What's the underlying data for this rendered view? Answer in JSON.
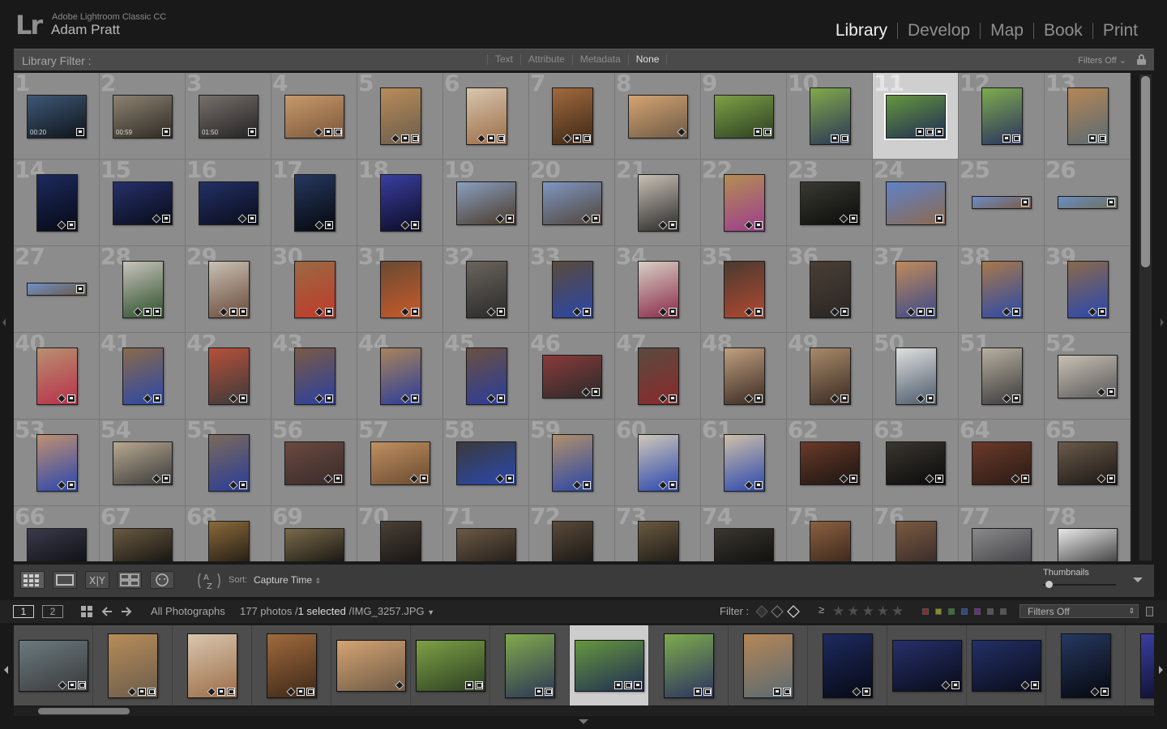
{
  "app": {
    "product": "Adobe Lightroom Classic CC",
    "user": "Adam Pratt",
    "logo": "Lr"
  },
  "modules": [
    {
      "label": "Library",
      "active": true
    },
    {
      "label": "Develop",
      "active": false
    },
    {
      "label": "Map",
      "active": false
    },
    {
      "label": "Book",
      "active": false
    },
    {
      "label": "Print",
      "active": false
    }
  ],
  "library_filter": {
    "label": "Library Filter :",
    "tabs": [
      {
        "label": "Text",
        "active": false
      },
      {
        "label": "Attribute",
        "active": false
      },
      {
        "label": "Metadata",
        "active": false
      },
      {
        "label": "None",
        "active": true
      }
    ],
    "preset": "Filters Off",
    "lock_icon": "lock-icon"
  },
  "grid": {
    "selected_index": 11,
    "cells": [
      {
        "n": "1",
        "c1": "#3e5878",
        "c2": "#0f1418",
        "o": "h",
        "dur": "00:20",
        "badges": [
          "cm"
        ]
      },
      {
        "n": "2",
        "c1": "#8d8273",
        "c2": "#2f2a22",
        "o": "h",
        "dur": "00:59",
        "badges": [
          "cm"
        ]
      },
      {
        "n": "3",
        "c1": "#77706a",
        "c2": "#242225",
        "o": "h",
        "dur": "01:50",
        "badges": [
          "cm"
        ]
      },
      {
        "n": "4",
        "c1": "#c79a6b",
        "c2": "#7b573a",
        "o": "h",
        "badges": [
          "kw",
          "cm",
          "cp"
        ]
      },
      {
        "n": "5",
        "c1": "#b88c5a",
        "c2": "#6b5c4a",
        "o": "v",
        "badges": [
          "kw",
          "cm",
          "cp"
        ]
      },
      {
        "n": "6",
        "c1": "#d8c6ae",
        "c2": "#9c6d47",
        "o": "v",
        "badges": [
          "kw",
          "cm",
          "cp"
        ]
      },
      {
        "n": "7",
        "c1": "#a06a3d",
        "c2": "#3d2717",
        "o": "v",
        "badges": [
          "kw",
          "cm",
          "cp"
        ]
      },
      {
        "n": "8",
        "c1": "#d4a473",
        "c2": "#6e5a45",
        "o": "h",
        "badges": [
          "kw"
        ]
      },
      {
        "n": "9",
        "c1": "#7fa046",
        "c2": "#2b3f22",
        "o": "h",
        "badges": [
          "cm",
          "cp"
        ]
      },
      {
        "n": "10",
        "c1": "#81a94b",
        "c2": "#2c3656",
        "o": "v",
        "badges": [
          "cm",
          "cp"
        ]
      },
      {
        "n": "11",
        "c1": "#66963e",
        "c2": "#1f2d53",
        "o": "h",
        "badges": [
          "cm",
          "cp",
          "ed"
        ]
      },
      {
        "n": "12",
        "c1": "#7eab4d",
        "c2": "#2b3260",
        "o": "v",
        "badges": [
          "cm",
          "cp"
        ]
      },
      {
        "n": "13",
        "c1": "#b58656",
        "c2": "#5a6a72",
        "o": "v",
        "badges": [
          "cm",
          "cp"
        ]
      },
      {
        "n": "14",
        "c1": "#1d2a5e",
        "c2": "#060914",
        "o": "v",
        "badges": [
          "kw",
          "cm"
        ]
      },
      {
        "n": "15",
        "c1": "#26306a",
        "c2": "#080b18",
        "o": "h",
        "badges": [
          "kw",
          "cm"
        ]
      },
      {
        "n": "16",
        "c1": "#223066",
        "c2": "#0a0c1a",
        "o": "h",
        "badges": [
          "kw",
          "cm"
        ]
      },
      {
        "n": "17",
        "c1": "#263860",
        "c2": "#05070c",
        "o": "v",
        "badges": [
          "kw",
          "cm"
        ]
      },
      {
        "n": "18",
        "c1": "#3a3fa0",
        "c2": "#0b0b25",
        "o": "v",
        "badges": [
          "kw",
          "cm"
        ]
      },
      {
        "n": "19",
        "c1": "#8a9fc0",
        "c2": "#4a3a2a",
        "o": "h",
        "badges": [
          "kw",
          "cm"
        ]
      },
      {
        "n": "20",
        "c1": "#7e97c2",
        "c2": "#51443a",
        "o": "h",
        "badges": [
          "kw",
          "cm"
        ]
      },
      {
        "n": "21",
        "c1": "#c8c0b5",
        "c2": "#2b2b2b",
        "o": "v",
        "badges": [
          "kw",
          "cm"
        ]
      },
      {
        "n": "22",
        "c1": "#b38e53",
        "c2": "#9d3d8e",
        "o": "v",
        "badges": [
          "kw",
          "cm"
        ]
      },
      {
        "n": "23",
        "c1": "#3a3a32",
        "c2": "#0a0a0a",
        "o": "h",
        "badges": [
          "kw",
          "cm"
        ]
      },
      {
        "n": "24",
        "c1": "#5f82c8",
        "c2": "#8c6a4f",
        "o": "h",
        "badges": [
          "cm"
        ]
      },
      {
        "n": "25",
        "c1": "#6a8cc8",
        "c2": "#7d5a3f",
        "o": "p",
        "badges": [
          "cm"
        ]
      },
      {
        "n": "26",
        "c1": "#6c8ec4",
        "c2": "#6d6f5a",
        "o": "p",
        "badges": [
          "cm"
        ]
      },
      {
        "n": "27",
        "c1": "#7090c8",
        "c2": "#6a5a45",
        "o": "p",
        "badges": [
          "cm"
        ]
      },
      {
        "n": "28",
        "c1": "#c8c3bc",
        "c2": "#2c4f2a",
        "o": "v",
        "badges": [
          "kw",
          "cm",
          "ed"
        ]
      },
      {
        "n": "29",
        "c1": "#c8c0b5",
        "c2": "#6a4a38",
        "o": "v",
        "badges": [
          "kw",
          "cm",
          "ed"
        ]
      },
      {
        "n": "30",
        "c1": "#9a6a43",
        "c2": "#c03a2a",
        "o": "v",
        "badges": [
          "kw",
          "cm"
        ]
      },
      {
        "n": "31",
        "c1": "#6a4a32",
        "c2": "#c85a2a",
        "o": "v",
        "badges": [
          "kw",
          "cm"
        ]
      },
      {
        "n": "32",
        "c1": "#6a645c",
        "c2": "#2a2a2a",
        "o": "v",
        "badges": [
          "kw",
          "cm"
        ]
      },
      {
        "n": "33",
        "c1": "#5a4a3a",
        "c2": "#2a46a8",
        "o": "v",
        "badges": [
          "kw",
          "cm"
        ]
      },
      {
        "n": "34",
        "c1": "#d8d0c4",
        "c2": "#8a2a4a",
        "o": "v",
        "badges": [
          "kw",
          "cm"
        ]
      },
      {
        "n": "35",
        "c1": "#4a3a30",
        "c2": "#b04830",
        "o": "v",
        "badges": [
          "kw",
          "cm"
        ]
      },
      {
        "n": "36",
        "c1": "#4a3e34",
        "c2": "#2a2624",
        "o": "v",
        "badges": [
          "kw",
          "cm"
        ]
      },
      {
        "n": "37",
        "c1": "#c08a5a",
        "c2": "#3a4a8a",
        "o": "v",
        "badges": [
          "kw",
          "cm",
          "ed"
        ]
      },
      {
        "n": "38",
        "c1": "#a8784a",
        "c2": "#2a4aa8",
        "o": "v",
        "badges": [
          "kw",
          "cm"
        ]
      },
      {
        "n": "39",
        "c1": "#8a6a4a",
        "c2": "#2a46b0",
        "o": "v",
        "badges": [
          "kw",
          "cm"
        ]
      },
      {
        "n": "40",
        "c1": "#b89070",
        "c2": "#b8304a",
        "o": "v",
        "badges": [
          "kw",
          "cm"
        ]
      },
      {
        "n": "41",
        "c1": "#8a6a4a",
        "c2": "#2a48a8",
        "o": "v",
        "badges": [
          "kw",
          "cm"
        ]
      },
      {
        "n": "42",
        "c1": "#b8503a",
        "c2": "#3a3a3a",
        "o": "v",
        "badges": [
          "kw",
          "cm"
        ]
      },
      {
        "n": "43",
        "c1": "#7a5a44",
        "c2": "#2a40a0",
        "o": "v",
        "badges": [
          "kw",
          "cm"
        ]
      },
      {
        "n": "44",
        "c1": "#a8845c",
        "c2": "#2a3c9a",
        "o": "v",
        "badges": [
          "kw",
          "cm"
        ]
      },
      {
        "n": "45",
        "c1": "#6a5040",
        "c2": "#2a3c9a",
        "o": "v",
        "badges": [
          "kw",
          "cm"
        ]
      },
      {
        "n": "46",
        "c1": "#8a3a3a",
        "c2": "#2a2a2a",
        "o": "h",
        "badges": [
          "kw",
          "cm"
        ]
      },
      {
        "n": "47",
        "c1": "#5a4a40",
        "c2": "#8a2a2a",
        "o": "v",
        "badges": [
          "kw",
          "cm"
        ]
      },
      {
        "n": "48",
        "c1": "#c0a080",
        "c2": "#3a2a22",
        "o": "v",
        "badges": [
          "kw",
          "cm"
        ]
      },
      {
        "n": "49",
        "c1": "#a88a6a",
        "c2": "#3a2a22",
        "o": "v",
        "badges": [
          "kw",
          "cm"
        ]
      },
      {
        "n": "50",
        "c1": "#e0e0e0",
        "c2": "#4a5a6a",
        "o": "v",
        "badges": [
          "kw",
          "cm"
        ]
      },
      {
        "n": "51",
        "c1": "#b8b0a0",
        "c2": "#3a3a3a",
        "o": "v",
        "badges": [
          "kw",
          "cm"
        ]
      },
      {
        "n": "52",
        "c1": "#c8c0b4",
        "c2": "#5a5a5a",
        "o": "h",
        "badges": [
          "kw",
          "cm"
        ]
      },
      {
        "n": "53",
        "c1": "#c09070",
        "c2": "#2a46b0",
        "o": "v",
        "badges": [
          "kw",
          "cm"
        ]
      },
      {
        "n": "54",
        "c1": "#b8a890",
        "c2": "#3a3a3a",
        "o": "h",
        "badges": [
          "kw",
          "cm"
        ]
      },
      {
        "n": "55",
        "c1": "#7a6a5a",
        "c2": "#2a3c98",
        "o": "v",
        "badges": [
          "kw",
          "cm"
        ]
      },
      {
        "n": "56",
        "c1": "#6a4a40",
        "c2": "#3a2a2a",
        "o": "h",
        "badges": [
          "kw",
          "cm"
        ]
      },
      {
        "n": "57",
        "c1": "#c09060",
        "c2": "#6a4a30",
        "o": "h",
        "badges": [
          "kw",
          "cm"
        ]
      },
      {
        "n": "58",
        "c1": "#3a3a3a",
        "c2": "#2a48b0",
        "o": "h",
        "badges": [
          "kw",
          "cm"
        ]
      },
      {
        "n": "59",
        "c1": "#b0906a",
        "c2": "#2a46a8",
        "o": "v",
        "badges": [
          "kw",
          "cm"
        ]
      },
      {
        "n": "60",
        "c1": "#d0c8b8",
        "c2": "#2a46b0",
        "o": "v",
        "badges": [
          "kw",
          "cm"
        ]
      },
      {
        "n": "61",
        "c1": "#d0c0a8",
        "c2": "#2a48b0",
        "o": "v",
        "badges": [
          "kw",
          "cm"
        ]
      },
      {
        "n": "62",
        "c1": "#6a3a2a",
        "c2": "#1a1410",
        "o": "h",
        "badges": [
          "kw",
          "cm"
        ]
      },
      {
        "n": "63",
        "c1": "#3a3630",
        "c2": "#0a0a0a",
        "o": "h",
        "badges": [
          "kw",
          "cm"
        ]
      },
      {
        "n": "64",
        "c1": "#6a3a2a",
        "c2": "#2a1a14",
        "o": "h",
        "badges": [
          "kw",
          "cm"
        ]
      },
      {
        "n": "65",
        "c1": "#6a5a4a",
        "c2": "#1a1614",
        "o": "h",
        "badges": [
          "kw",
          "cm"
        ]
      },
      {
        "n": "66",
        "c1": "#3a3a4a",
        "c2": "#0a0a10",
        "o": "h",
        "badges": []
      },
      {
        "n": "67",
        "c1": "#6a5a40",
        "c2": "#0a0a0a",
        "o": "h",
        "badges": []
      },
      {
        "n": "68",
        "c1": "#8a6a3a",
        "c2": "#0a0a0a",
        "o": "v",
        "badges": []
      },
      {
        "n": "69",
        "c1": "#7a6a4a",
        "c2": "#0a0a0a",
        "o": "h",
        "badges": []
      },
      {
        "n": "70",
        "c1": "#4a4036",
        "c2": "#0a0a0a",
        "o": "v",
        "badges": []
      },
      {
        "n": "71",
        "c1": "#6a5a44",
        "c2": "#1a1414",
        "o": "h",
        "badges": []
      },
      {
        "n": "72",
        "c1": "#5a4a3a",
        "c2": "#0a0a0a",
        "o": "v",
        "badges": []
      },
      {
        "n": "73",
        "c1": "#6a5a40",
        "c2": "#0a0a0a",
        "o": "v",
        "badges": []
      },
      {
        "n": "74",
        "c1": "#3a3630",
        "c2": "#0a0a0a",
        "o": "h",
        "badges": []
      },
      {
        "n": "75",
        "c1": "#8a6040",
        "c2": "#2a1a14",
        "o": "v",
        "badges": []
      },
      {
        "n": "76",
        "c1": "#7a5a40",
        "c2": "#2a2024",
        "o": "v",
        "badges": []
      },
      {
        "n": "77",
        "c1": "#8a8a8a",
        "c2": "#3a3a40",
        "o": "h",
        "badges": []
      },
      {
        "n": "78",
        "c1": "#e8e8e8",
        "c2": "#2a2a2a",
        "o": "h",
        "badges": []
      }
    ]
  },
  "toolbar": {
    "sort_label": "Sort:",
    "sort_value": "Capture Time",
    "thumbnails_label": "Thumbnails",
    "thumbnail_size": 0.02,
    "view_icons": [
      "grid-view-icon",
      "loupe-view-icon",
      "compare-view-icon",
      "survey-view-icon",
      "people-view-icon"
    ]
  },
  "filmstrip_bar": {
    "screen1": "1",
    "screen2": "2",
    "source": "All Photographs",
    "count": "177 photos /",
    "selected": "1 selected",
    "filename": "/IMG_3257.JPG",
    "filter_label": "Filter :",
    "rating_op": "≥",
    "stars": "★★★★★",
    "filters_select": "Filters Off",
    "swatch_colors": [
      "#8a2a2a",
      "#8a8a2a",
      "#2a7a2a",
      "#2a4a8a",
      "#6a2a8a",
      "#555555",
      "#555555"
    ]
  },
  "filmstrip": {
    "selected_index": 7,
    "items": [
      {
        "c1": "#6a7a80",
        "c2": "#3a3a3a",
        "o": "h",
        "badges": [
          "kw",
          "cm",
          "cp"
        ]
      },
      {
        "c1": "#b88c5a",
        "c2": "#6b5c4a",
        "o": "v",
        "badges": [
          "kw",
          "cm",
          "cp"
        ]
      },
      {
        "c1": "#d8c6ae",
        "c2": "#9c6d47",
        "o": "v",
        "badges": [
          "kw",
          "cm",
          "cp"
        ]
      },
      {
        "c1": "#a06a3d",
        "c2": "#3d2717",
        "o": "v",
        "badges": [
          "kw",
          "cm",
          "cp"
        ]
      },
      {
        "c1": "#d4a473",
        "c2": "#6e5a45",
        "o": "h",
        "badges": [
          "kw"
        ]
      },
      {
        "c1": "#7fa046",
        "c2": "#2b3f22",
        "o": "h",
        "badges": [
          "cm",
          "cp"
        ]
      },
      {
        "c1": "#81a94b",
        "c2": "#2c3656",
        "o": "v",
        "badges": [
          "cm",
          "cp"
        ]
      },
      {
        "c1": "#66963e",
        "c2": "#1f2d53",
        "o": "h",
        "badges": [
          "cm",
          "cp",
          "ed"
        ]
      },
      {
        "c1": "#7eab4d",
        "c2": "#2b3260",
        "o": "v",
        "badges": [
          "cm",
          "cp"
        ]
      },
      {
        "c1": "#b58656",
        "c2": "#5a6a72",
        "o": "v",
        "badges": [
          "cm",
          "cp"
        ]
      },
      {
        "c1": "#1d2a5e",
        "c2": "#060914",
        "o": "v",
        "badges": [
          "kw",
          "cm"
        ]
      },
      {
        "c1": "#26306a",
        "c2": "#080b18",
        "o": "h",
        "badges": [
          "kw",
          "cm"
        ]
      },
      {
        "c1": "#223066",
        "c2": "#0a0c1a",
        "o": "h",
        "badges": [
          "kw",
          "cm"
        ]
      },
      {
        "c1": "#263860",
        "c2": "#05070c",
        "o": "v",
        "badges": [
          "kw",
          "cm"
        ]
      },
      {
        "c1": "#3a3fa0",
        "c2": "#0b0b25",
        "o": "v",
        "badges": [
          "kw"
        ]
      }
    ]
  },
  "colors": {
    "panel_bg": "#4a4a4a",
    "grid_cell": "#8c8c8c",
    "selected_cell": "#cfcfcf",
    "active_module": "#efefef"
  }
}
